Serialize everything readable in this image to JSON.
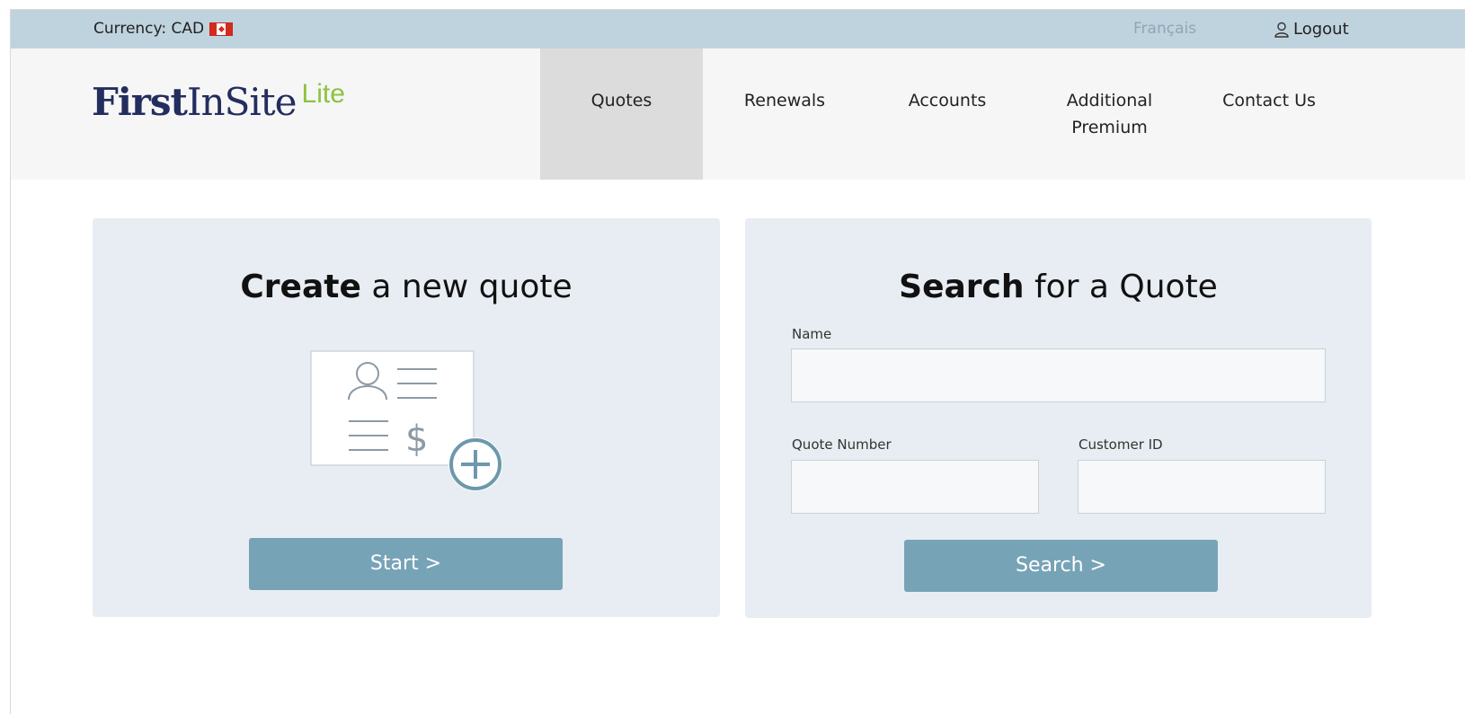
{
  "topbar": {
    "currency_label": "Currency: CAD",
    "flag_icon": "canada-flag-icon",
    "language_link": "Français",
    "logout_label": "Logout",
    "logout_icon": "user-icon"
  },
  "brand": {
    "part1": "First",
    "part2": "InSite",
    "suffix": "Lite",
    "colors": {
      "primary": "#232d5e",
      "accent": "#8cc13f"
    }
  },
  "nav": {
    "items": [
      {
        "label": "Quotes",
        "active": true
      },
      {
        "label": "Renewals",
        "active": false
      },
      {
        "label": "Accounts",
        "active": false
      },
      {
        "label": "Additional Premium",
        "active": false
      },
      {
        "label": "Contact Us",
        "active": false
      }
    ]
  },
  "create_card": {
    "title_bold": "Create",
    "title_rest": " a new quote",
    "illustration_icon": "quote-document-add-icon",
    "start_button": "Start >"
  },
  "search_card": {
    "title_bold": "Search",
    "title_rest": " for a Quote",
    "name_label": "Name",
    "name_value": "",
    "quote_number_label": "Quote Number",
    "quote_number_value": "",
    "customer_id_label": "Customer ID",
    "customer_id_value": "",
    "search_button": "Search >"
  },
  "colors": {
    "topbar_bg": "#bfd3de",
    "nav_bg": "#f6f6f6",
    "nav_active_bg": "#dcdcdc",
    "card_bg": "#e7edf2",
    "button_bg": "#77a3b7"
  }
}
